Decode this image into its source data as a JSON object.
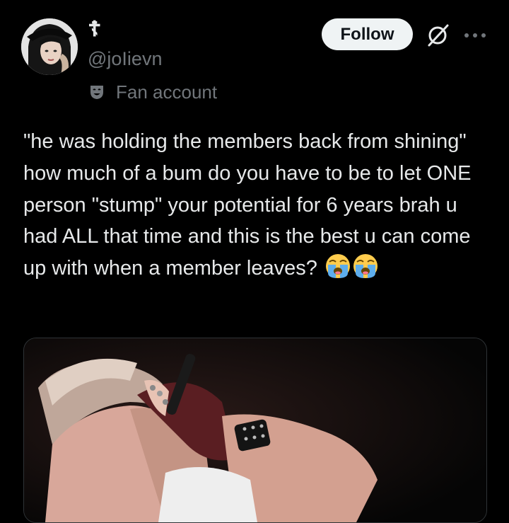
{
  "author": {
    "display_name": "☦",
    "handle": "@joIievn",
    "label": "Fan account",
    "avatar_icon": "avatar-photo",
    "label_icon": "theater-mask-icon"
  },
  "actions": {
    "follow_label": "Follow",
    "grok_icon": "grok-icon",
    "more_icon": "more-horizontal-icon"
  },
  "post": {
    "text": "\"he was holding the members back from shining\" how much of a bum do you have to be to let ONE person \"stump\" your potential for 6 years brah u had ALL that time and this is the best u can come up with when a member leaves?",
    "emojis": [
      "😭",
      "😭"
    ]
  },
  "media": {
    "type": "video-thumbnail",
    "icon": "media-image"
  },
  "colors": {
    "background": "#000000",
    "text_primary": "#e7e9ea",
    "text_secondary": "#71767b",
    "follow_bg": "#eff3f4",
    "follow_text": "#0f1419"
  }
}
